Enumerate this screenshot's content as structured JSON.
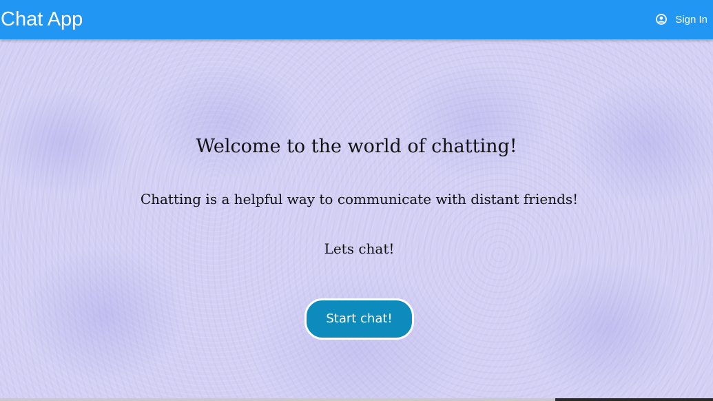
{
  "navbar": {
    "brand": "Chat App",
    "signin_label": "Sign In",
    "signin_icon": "user-circle-icon"
  },
  "hero": {
    "headline": "Welcome to the world of chatting!",
    "subline": "Chatting is a helpful way to communicate with distant friends!",
    "cta_text": "Lets chat!",
    "start_button": "Start chat!"
  },
  "colors": {
    "navbar": "#2196f3",
    "background": "#d3d0f4",
    "button": "#0e8bbd",
    "text": "#111111"
  }
}
